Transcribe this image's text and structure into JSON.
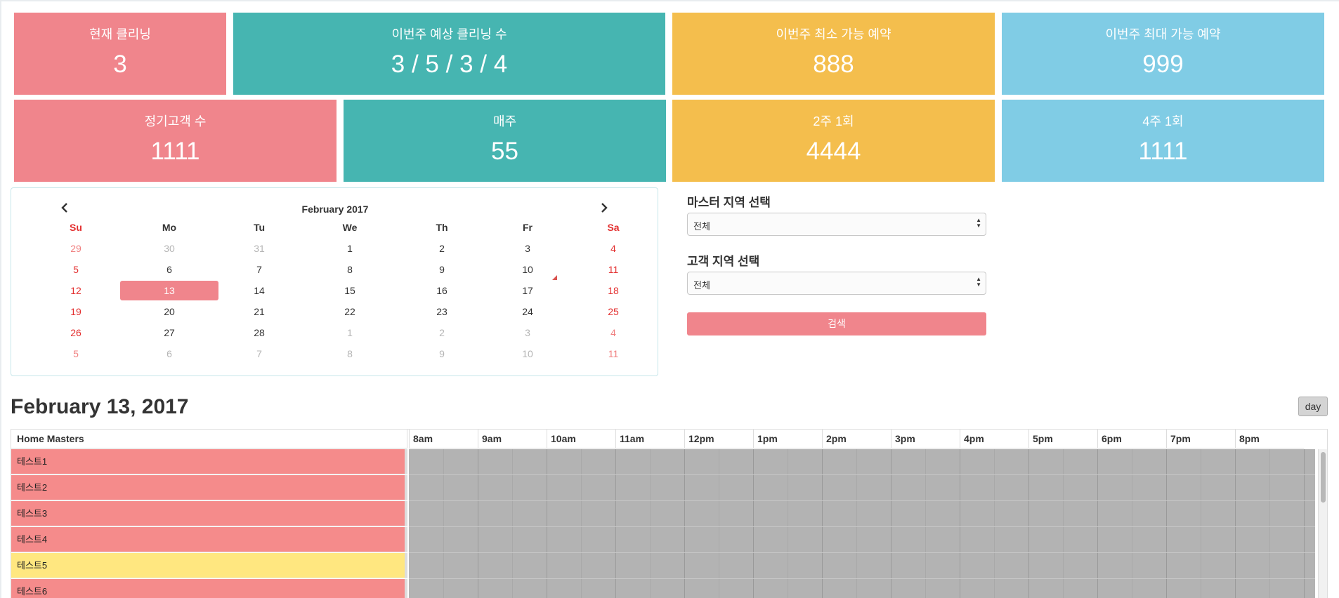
{
  "stats": {
    "row1": [
      {
        "label": "현재 클리닝",
        "value": "3",
        "color": "#f0858c"
      },
      {
        "label": "이번주 예상 클리닝 수",
        "value": "3 / 5 / 3 / 4",
        "color": "#46b5b1"
      },
      {
        "label": "이번주 최소 가능 예약",
        "value": "888",
        "color": "#f4be4d"
      },
      {
        "label": "이번주 최대 가능 예약",
        "value": "999",
        "color": "#80cce5"
      }
    ],
    "row2": [
      {
        "label": "정기고객 수",
        "value": "1111",
        "color": "#f0858c"
      },
      {
        "label": "매주",
        "value": "55",
        "color": "#46b5b1"
      },
      {
        "label": "2주 1회",
        "value": "4444",
        "color": "#f4be4d"
      },
      {
        "label": "4주 1회",
        "value": "1111",
        "color": "#80cce5"
      }
    ]
  },
  "calendar": {
    "title": "February 2017",
    "prev_icon": "chevron-left-icon",
    "next_icon": "chevron-right-icon",
    "weekdays": [
      "Su",
      "Mo",
      "Tu",
      "We",
      "Th",
      "Fr",
      "Sa"
    ],
    "weeks": [
      [
        "29",
        "30",
        "31",
        "1",
        "2",
        "3",
        "4"
      ],
      [
        "5",
        "6",
        "7",
        "8",
        "9",
        "10",
        "11"
      ],
      [
        "12",
        "13",
        "14",
        "15",
        "16",
        "17",
        "18"
      ],
      [
        "19",
        "20",
        "21",
        "22",
        "23",
        "24",
        "25"
      ],
      [
        "26",
        "27",
        "28",
        "1",
        "2",
        "3",
        "4"
      ],
      [
        "5",
        "6",
        "7",
        "8",
        "9",
        "10",
        "11"
      ]
    ],
    "selected_day": "13"
  },
  "filters": {
    "master_region_label": "마스터 지역 선택",
    "master_region_value": "전체",
    "customer_region_label": "고객 지역 선택",
    "customer_region_value": "전체",
    "search_label": "검색"
  },
  "schedule": {
    "date_heading": "February 13, 2017",
    "view_button": "day",
    "resource_header": "Home Masters",
    "time_slots": [
      "8am",
      "9am",
      "10am",
      "11am",
      "12pm",
      "1pm",
      "2pm",
      "3pm",
      "4pm",
      "5pm",
      "6pm",
      "7pm",
      "8pm"
    ],
    "masters": [
      {
        "name": "테스트1",
        "color": "#f58b8b"
      },
      {
        "name": "테스트2",
        "color": "#f58b8b"
      },
      {
        "name": "테스트3",
        "color": "#f58b8b"
      },
      {
        "name": "테스트4",
        "color": "#f58b8b"
      },
      {
        "name": "테스트5",
        "color": "#ffe780"
      },
      {
        "name": "테스트6",
        "color": "#f58b8b"
      }
    ]
  }
}
